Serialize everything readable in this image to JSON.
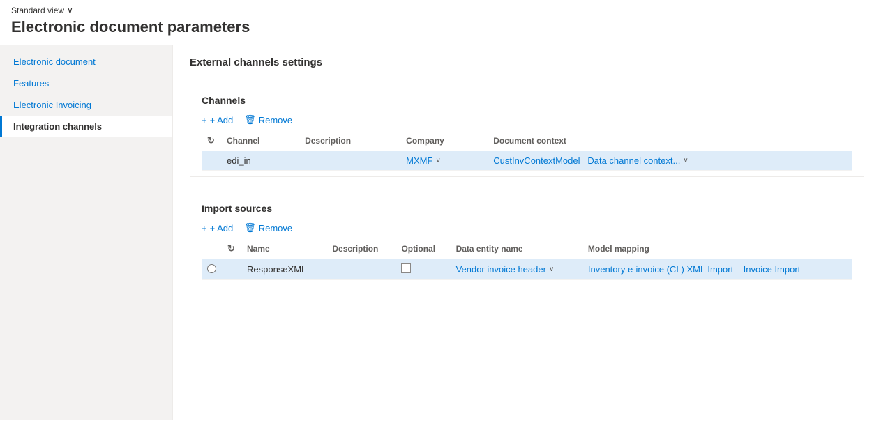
{
  "header": {
    "view_selector": "Standard view",
    "chevron": "∨",
    "page_title": "Electronic document parameters"
  },
  "sidebar": {
    "items": [
      {
        "id": "electronic-document",
        "label": "Electronic document",
        "active": false
      },
      {
        "id": "features",
        "label": "Features",
        "active": false
      },
      {
        "id": "electronic-invoicing",
        "label": "Electronic Invoicing",
        "active": false
      },
      {
        "id": "integration-channels",
        "label": "Integration channels",
        "active": true
      }
    ]
  },
  "main": {
    "section_title": "External channels settings",
    "channels": {
      "heading": "Channels",
      "add_label": "+ Add",
      "remove_label": "Remove",
      "columns": [
        {
          "id": "refresh",
          "label": ""
        },
        {
          "id": "channel",
          "label": "Channel"
        },
        {
          "id": "description",
          "label": "Description"
        },
        {
          "id": "company",
          "label": "Company"
        },
        {
          "id": "document_context",
          "label": "Document context"
        }
      ],
      "rows": [
        {
          "selected": true,
          "channel": "edi_in",
          "description": "",
          "company": "MXMF",
          "document_context_model": "CustInvContextModel",
          "document_context_value": "Data channel context..."
        }
      ]
    },
    "import_sources": {
      "heading": "Import sources",
      "add_label": "+ Add",
      "remove_label": "Remove",
      "columns": [
        {
          "id": "radio",
          "label": ""
        },
        {
          "id": "refresh",
          "label": ""
        },
        {
          "id": "name",
          "label": "Name"
        },
        {
          "id": "description",
          "label": "Description"
        },
        {
          "id": "optional",
          "label": "Optional"
        },
        {
          "id": "data_entity_name",
          "label": "Data entity name"
        },
        {
          "id": "model_mapping",
          "label": "Model mapping"
        }
      ],
      "rows": [
        {
          "selected": true,
          "name": "ResponseXML",
          "description": "",
          "optional": false,
          "data_entity_name": "Vendor invoice header",
          "model_mapping": "Inventory e-invoice (CL) XML Import",
          "model_mapping_link": "Invoice Import"
        }
      ]
    }
  },
  "icons": {
    "plus": "+",
    "trash": "🗑",
    "chevron_down": "∨",
    "refresh": "↻"
  }
}
